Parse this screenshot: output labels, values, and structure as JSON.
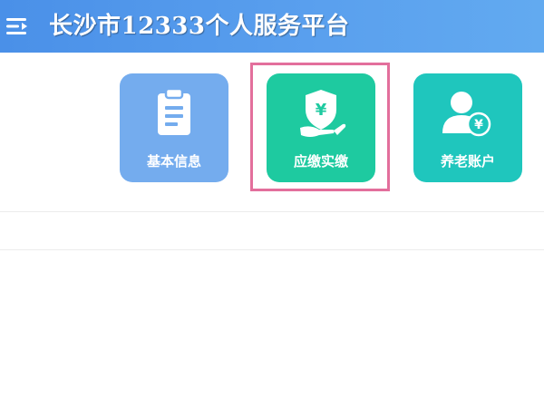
{
  "header": {
    "title": "长沙市12333个人服务平台",
    "menu_icon": "menu-icon",
    "background_color": "#4a90e8"
  },
  "tiles": [
    {
      "label": "基本信息",
      "icon": "clipboard-icon",
      "color": "#74acee"
    },
    {
      "label": "应缴实缴",
      "icon": "hand-shield-yen-icon",
      "color": "#1ecaa0",
      "highlighted": true
    },
    {
      "label": "养老账户",
      "icon": "user-yen-icon",
      "color": "#1fc6bd"
    }
  ],
  "highlight_color": "#e36f9c"
}
